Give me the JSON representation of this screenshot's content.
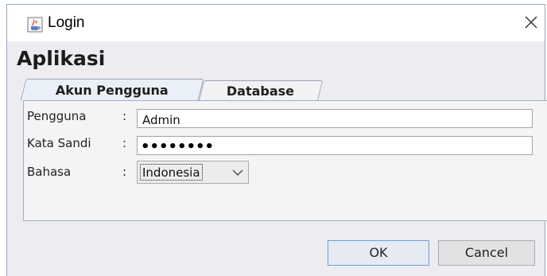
{
  "window": {
    "title": "Login",
    "app_icon": "java-cup-icon",
    "close_icon": "close-icon"
  },
  "heading": "Aplikasi",
  "tabs": [
    {
      "label": "Akun Pengguna",
      "active": true
    },
    {
      "label": "Database",
      "active": false
    }
  ],
  "form": {
    "username_label": "Pengguna",
    "username_value": "Admin",
    "password_label": "Kata Sandi",
    "password_mask": "••••••••",
    "language_label": "Bahasa",
    "language_value": "Indonesia",
    "separator": ":"
  },
  "buttons": {
    "ok": "OK",
    "cancel": "Cancel"
  }
}
